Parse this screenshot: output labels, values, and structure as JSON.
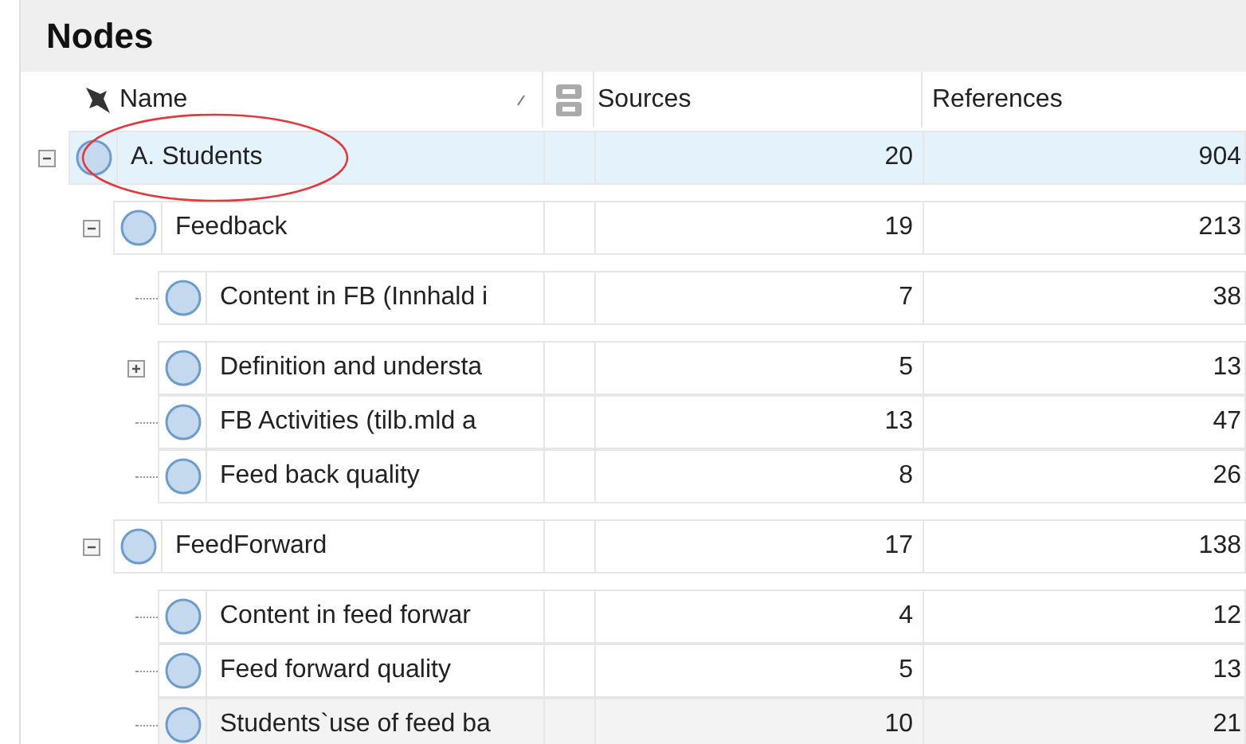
{
  "panel": {
    "title": "Nodes"
  },
  "columns": [
    {
      "label": "Name",
      "sorted": true
    },
    {
      "label": "Sources"
    },
    {
      "label": "References"
    }
  ],
  "highlight_ellipse": true,
  "nodes": [
    {
      "kind": "branch",
      "name": "A. Students",
      "sources": "20",
      "references": "904",
      "selected": true,
      "hovered": false,
      "expanded": true,
      "children": [
        {
          "kind": "branch",
          "name": "Feedback",
          "sources": "19",
          "references": "213",
          "selected": false,
          "hovered": false,
          "expanded": true,
          "children": [
            {
              "kind": "leaf",
              "name": "Content in FB (Innhald i",
              "sources": "7",
              "references": "38",
              "selected": false,
              "hovered": false
            },
            {
              "kind": "branch",
              "name": "Definition and understa",
              "sources": "5",
              "references": "13",
              "selected": false,
              "hovered": false,
              "expanded": false
            },
            {
              "kind": "leaf",
              "name": "FB Activities (tilb.mld a",
              "sources": "13",
              "references": "47",
              "selected": false,
              "hovered": false
            },
            {
              "kind": "leaf",
              "name": "Feed back quality",
              "sources": "8",
              "references": "26",
              "selected": false,
              "hovered": false
            }
          ]
        },
        {
          "kind": "branch",
          "name": "FeedForward",
          "sources": "17",
          "references": "138",
          "selected": false,
          "hovered": false,
          "expanded": true,
          "children": [
            {
              "kind": "leaf",
              "name": "Content in feed forwar",
              "sources": "4",
              "references": "12",
              "selected": false,
              "hovered": false
            },
            {
              "kind": "leaf",
              "name": "Feed forward quality",
              "sources": "5",
              "references": "13",
              "selected": false,
              "hovered": false
            },
            {
              "kind": "leaf",
              "name": "Students`use of feed ba",
              "sources": "10",
              "references": "21",
              "selected": false,
              "hovered": true
            }
          ]
        }
      ]
    }
  ]
}
